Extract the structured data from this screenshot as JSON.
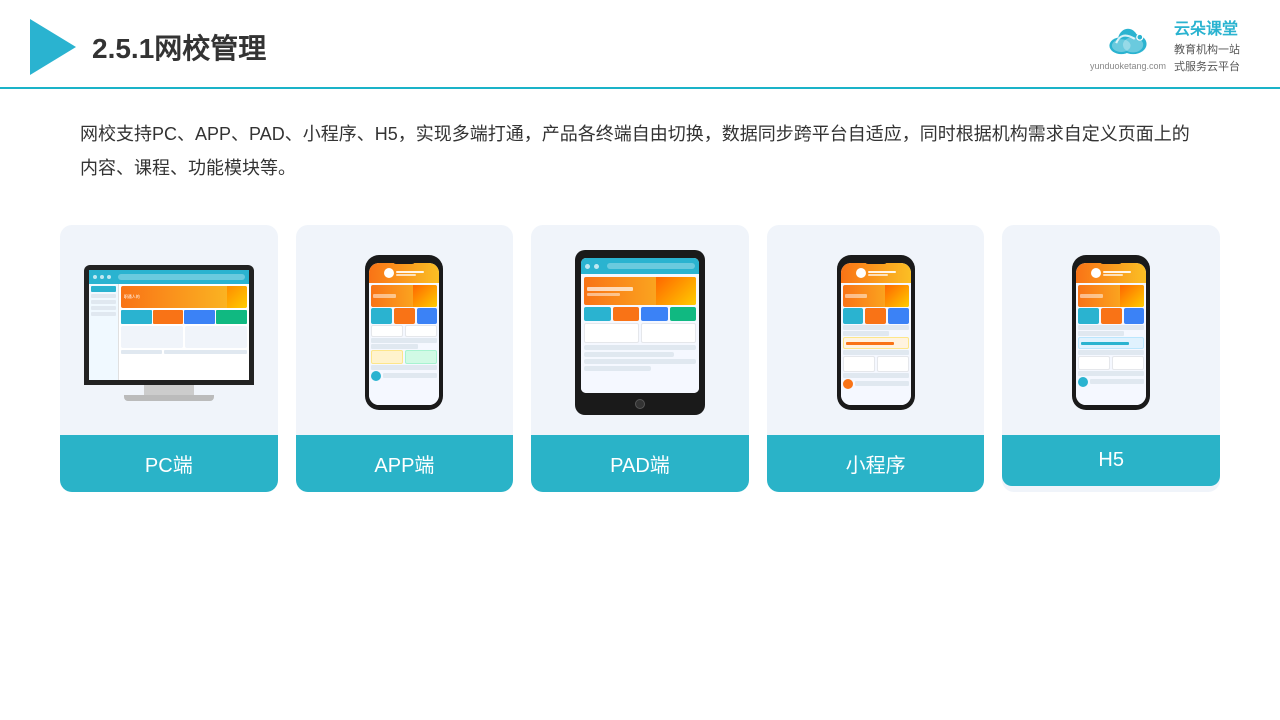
{
  "header": {
    "title": "2.5.1网校管理",
    "title_prefix": "2.5.1",
    "title_main": "网校管理"
  },
  "brand": {
    "name": "云朵课堂",
    "domain": "yunduoketang.com",
    "tagline1": "教育机构一站",
    "tagline2": "式服务云平台"
  },
  "description": {
    "text": "网校支持PC、APP、PAD、小程序、H5，实现多端打通，产品各终端自由切换，数据同步跨平台自适应，同时根据机构需求自定义页面上的内容、课程、功能模块等。"
  },
  "cards": [
    {
      "id": "pc",
      "label": "PC端"
    },
    {
      "id": "app",
      "label": "APP端"
    },
    {
      "id": "pad",
      "label": "PAD端"
    },
    {
      "id": "miniprogram",
      "label": "小程序"
    },
    {
      "id": "h5",
      "label": "H5"
    }
  ]
}
